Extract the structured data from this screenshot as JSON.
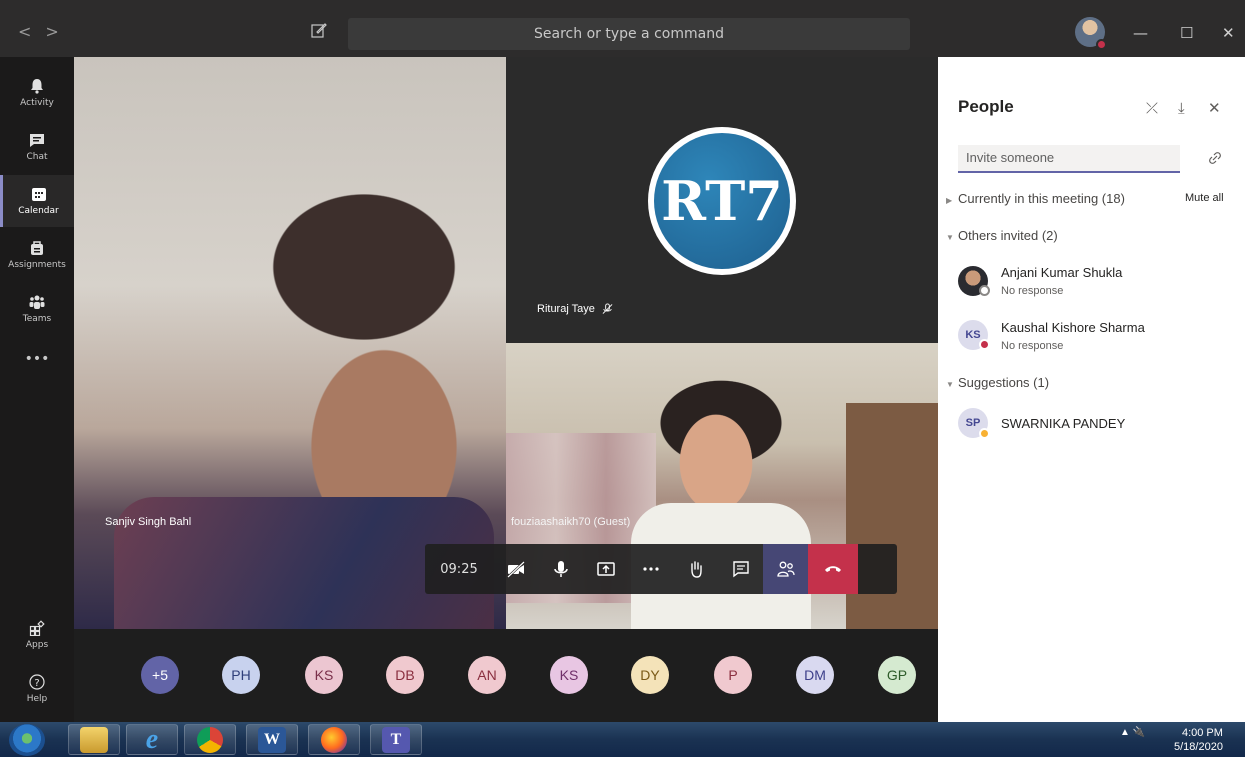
{
  "titlebar": {
    "search_placeholder": "Search or type a command",
    "back_icon": "<",
    "forward_icon": ">",
    "minimize": "—",
    "maximize": "☐",
    "close": "✕"
  },
  "rail": {
    "items": [
      {
        "label": "Activity",
        "icon": "bell-icon"
      },
      {
        "label": "Chat",
        "icon": "chat-icon"
      },
      {
        "label": "Calendar",
        "icon": "calendar-icon",
        "active": true
      },
      {
        "label": "Assignments",
        "icon": "assignments-icon"
      },
      {
        "label": "Teams",
        "icon": "teams-icon"
      },
      {
        "label": "•••",
        "icon": "more-icon"
      }
    ],
    "bottom": [
      {
        "label": "Apps",
        "icon": "apps-icon"
      },
      {
        "label": "Help",
        "icon": "help-icon"
      }
    ]
  },
  "stage": {
    "left_name": "Sanjiv Singh Bahl",
    "top_name": "Rituraj Taye",
    "bottom_name": "fouziaashaikh70 (Guest)",
    "logo_text": "RT7"
  },
  "controls": {
    "timer": "09:25",
    "buttons": [
      "camera-off",
      "mic",
      "share",
      "more",
      "raise-hand",
      "chat",
      "participants",
      "hang-up"
    ]
  },
  "participants_strip": [
    {
      "initials": "+5",
      "bg": "#6264a7",
      "fg": "#ffffff"
    },
    {
      "initials": "PH",
      "bg": "#c8d2ee",
      "fg": "#2f3f7a"
    },
    {
      "initials": "KS",
      "bg": "#ecc6d1",
      "fg": "#7a2f4a"
    },
    {
      "initials": "DB",
      "bg": "#f0c9cf",
      "fg": "#8a2f3f"
    },
    {
      "initials": "AN",
      "bg": "#f0c9cf",
      "fg": "#8a2f3f"
    },
    {
      "initials": "KS",
      "bg": "#e8c6e3",
      "fg": "#6f2f6a"
    },
    {
      "initials": "DY",
      "bg": "#f4e3b9",
      "fg": "#7a5a17"
    },
    {
      "initials": "P",
      "bg": "#f0c9cf",
      "fg": "#8a2f3f"
    },
    {
      "initials": "DM",
      "bg": "#d9d9f0",
      "fg": "#3d3f8a"
    },
    {
      "initials": "GP",
      "bg": "#d5ead0",
      "fg": "#2e5c2a"
    }
  ],
  "people": {
    "title": "People",
    "invite_placeholder": "Invite someone",
    "in_meeting": "Currently in this meeting (18)",
    "mute_all": "Mute all",
    "others_invited": "Others invited (2)",
    "invited": [
      {
        "name": "Anjani Kumar Shukla",
        "status": "No response",
        "initials": "",
        "photo": true,
        "status_color": "#8a8886"
      },
      {
        "name": "Kaushal Kishore Sharma",
        "status": "No response",
        "initials": "KS",
        "photo": false,
        "status_color": "#c4314b"
      }
    ],
    "suggestions": "Suggestions (1)",
    "suggested": [
      {
        "name": "SWARNIKA PANDEY",
        "initials": "SP",
        "status_color": "#f8b133"
      }
    ]
  },
  "taskbar": {
    "clock_time": "4:00 PM",
    "clock_date": "5/18/2020",
    "apps": [
      "start-orb",
      "file-explorer",
      "internet-explorer",
      "chrome",
      "word",
      "firefox",
      "teams"
    ]
  }
}
